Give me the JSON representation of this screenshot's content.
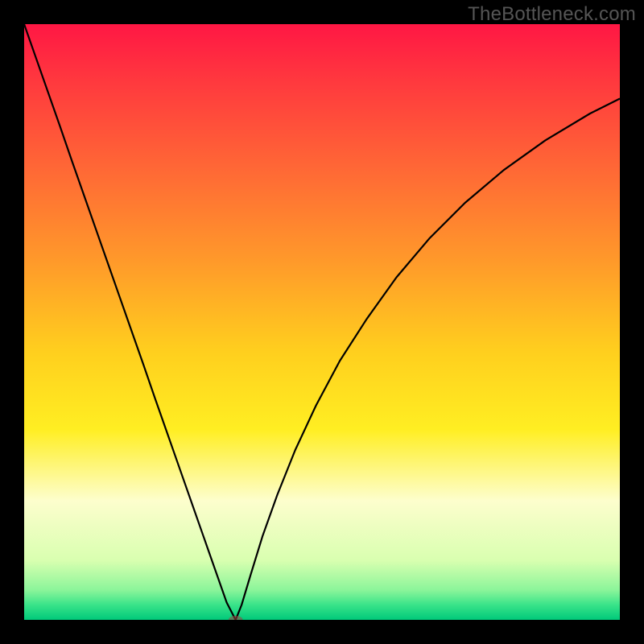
{
  "watermark": "TheBottleneck.com",
  "chart_data": {
    "type": "line",
    "title": "",
    "xlabel": "",
    "ylabel": "",
    "xlim": [
      0,
      100
    ],
    "ylim": [
      0,
      100
    ],
    "grid": false,
    "legend": false,
    "gradient_stops": [
      {
        "offset": 0.0,
        "color": "#ff1744"
      },
      {
        "offset": 0.1,
        "color": "#ff3a3e"
      },
      {
        "offset": 0.25,
        "color": "#ff6a35"
      },
      {
        "offset": 0.4,
        "color": "#ff9a2a"
      },
      {
        "offset": 0.55,
        "color": "#ffcf1e"
      },
      {
        "offset": 0.68,
        "color": "#ffee22"
      },
      {
        "offset": 0.8,
        "color": "#fdfecd"
      },
      {
        "offset": 0.9,
        "color": "#d9ffb0"
      },
      {
        "offset": 0.95,
        "color": "#8bf59a"
      },
      {
        "offset": 0.975,
        "color": "#39e389"
      },
      {
        "offset": 1.0,
        "color": "#00c97a"
      }
    ],
    "series": [
      {
        "name": "left-branch",
        "x": [
          0.0,
          2.0,
          4.0,
          6.0,
          8.0,
          10.0,
          12.0,
          14.0,
          16.0,
          18.0,
          20.0,
          22.0,
          24.0,
          26.0,
          28.0,
          30.0,
          32.0,
          34.0,
          35.5
        ],
        "y": [
          100.0,
          94.3,
          88.6,
          82.9,
          77.1,
          71.4,
          65.7,
          60.0,
          54.3,
          48.6,
          42.9,
          37.1,
          31.4,
          25.7,
          20.0,
          14.3,
          8.6,
          2.9,
          0.0
        ]
      },
      {
        "name": "right-branch",
        "x": [
          35.5,
          36.5,
          38.0,
          40.0,
          42.5,
          45.5,
          49.0,
          53.0,
          57.5,
          62.5,
          68.0,
          74.0,
          80.5,
          87.5,
          95.0,
          100.0
        ],
        "y": [
          0.0,
          2.5,
          7.5,
          14.0,
          21.0,
          28.5,
          36.0,
          43.5,
          50.5,
          57.5,
          64.0,
          70.0,
          75.5,
          80.5,
          85.0,
          87.5
        ]
      }
    ],
    "marker": {
      "name": "Optimal point",
      "x": 35.5,
      "y": 0.0,
      "w_pct": 2.4,
      "h_pct": 1.4,
      "color": "#a04040"
    }
  }
}
